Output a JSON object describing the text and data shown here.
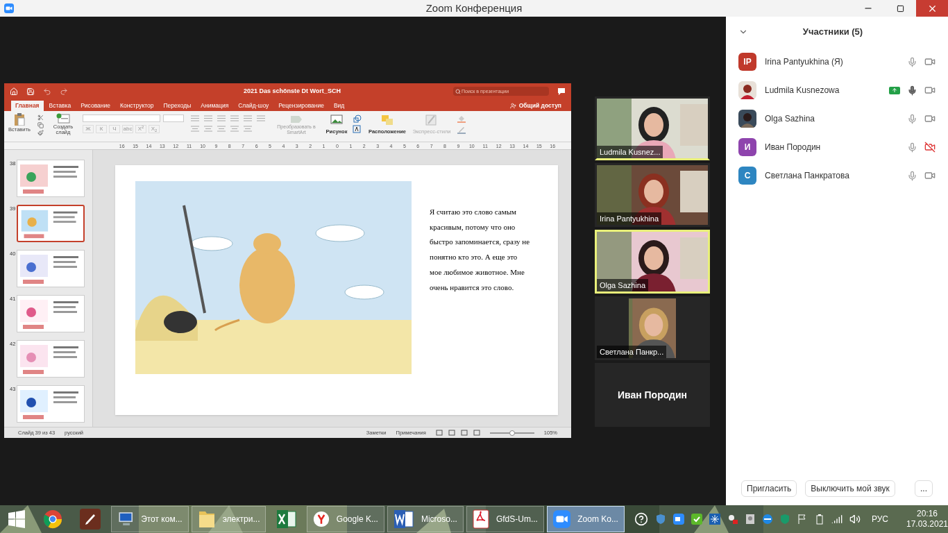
{
  "window": {
    "title": "Zoom Конференция"
  },
  "presentation": {
    "title": "2021 Das schönste Dt Wort_SCH",
    "search_placeholder": "Поиск в презентации",
    "share": "Общий доступ",
    "tabs": [
      {
        "label": "Главная",
        "selected": true
      },
      {
        "label": "Вставка",
        "selected": false
      },
      {
        "label": "Рисование",
        "selected": false
      },
      {
        "label": "Конструктор",
        "selected": false
      },
      {
        "label": "Переходы",
        "selected": false
      },
      {
        "label": "Анимация",
        "selected": false
      },
      {
        "label": "Слайд-шоу",
        "selected": false
      },
      {
        "label": "Рецензирование",
        "selected": false
      },
      {
        "label": "Вид",
        "selected": false
      }
    ],
    "ribbon": {
      "paste": "Вставить",
      "new_slide": "Создать слайд",
      "font_buttons": [
        "Ж",
        "К",
        "Ч",
        "abc",
        "X$^{2}$",
        "X$_{2}$"
      ],
      "smartart": "Преобразовать в SmartArt",
      "picture": "Рисунок",
      "arrange": "Расположение",
      "styles": "Экспресс-стили"
    },
    "ruler": [
      "16",
      "15",
      "14",
      "13",
      "12",
      "11",
      "10",
      "9",
      "8",
      "7",
      "6",
      "5",
      "4",
      "3",
      "2",
      "1",
      "0",
      "1",
      "2",
      "3",
      "4",
      "5",
      "6",
      "7",
      "8",
      "9",
      "10",
      "11",
      "12",
      "13",
      "14",
      "15",
      "16"
    ],
    "thumbnails": [
      {
        "number": "38",
        "selected": false
      },
      {
        "number": "39",
        "selected": true
      },
      {
        "number": "40",
        "selected": false
      },
      {
        "number": "41",
        "selected": false
      },
      {
        "number": "42",
        "selected": false
      },
      {
        "number": "43",
        "selected": false
      }
    ],
    "slide": {
      "text": "Я считаю это слово самым красивым, потому что оно быстро запоминается, сразу не понятно кто это. А еще это мое любимое животное. Мне очень нравится это слово."
    },
    "status": {
      "slide_info": "Слайд 39 из 43",
      "language": "русский",
      "notes": "Заметки",
      "comments": "Примечания",
      "zoom": "105%",
      "level": 0.5
    }
  },
  "videos": [
    {
      "name": "Ludmila Kusnez...",
      "kind": "video",
      "selected": false,
      "speaking": true
    },
    {
      "name": "Irina Pantyukhina",
      "kind": "video",
      "selected": false,
      "speaking": false
    },
    {
      "name": "Olga Sazhina",
      "kind": "video",
      "selected": true,
      "speaking": false
    },
    {
      "name": "Светлана Панкр...",
      "kind": "video",
      "selected": false,
      "speaking": false
    },
    {
      "name": "Иван Породин",
      "kind": "name",
      "selected": false,
      "speaking": false
    }
  ],
  "participants": {
    "title": "Участники (5)",
    "items": [
      {
        "name": "Irina Pantyukhina (Я)",
        "kind": "initials",
        "initials": "IP",
        "color": "#c0392b",
        "sharing": false,
        "mic_active": false,
        "video_off": false
      },
      {
        "name": "Ludmila Kusnezowa",
        "sharing": true,
        "mic_active": true,
        "video_off": false
      },
      {
        "name": "Olga Sazhina",
        "sharing": false,
        "mic_active": false,
        "video_off": false
      },
      {
        "name": "Иван Породин",
        "kind": "initials",
        "initials": "И",
        "color": "#8e44ad",
        "sharing": false,
        "mic_active": false,
        "video_off": true
      },
      {
        "name": "Светлана Панкратова",
        "kind": "initials",
        "initials": "С",
        "color": "#2e86c1",
        "sharing": false,
        "mic_active": false,
        "video_off": false
      }
    ],
    "buttons": [
      "Пригласить",
      "Выключить мой звук",
      "..."
    ]
  },
  "taskbar": {
    "items": [
      {
        "kind": "start"
      },
      {
        "kind": "chrome"
      },
      {
        "kind": "pen"
      },
      {
        "kind": "computer",
        "label": "Этот ком...",
        "selected": false
      },
      {
        "kind": "folder",
        "label": "электри...",
        "selected": false
      },
      {
        "kind": "excel"
      },
      {
        "kind": "yandex",
        "label": "Google K...",
        "selected": false
      },
      {
        "kind": "word",
        "label": "Microso...",
        "selected": false
      },
      {
        "kind": "pdf",
        "label": "GfdS-Um...",
        "selected": false
      },
      {
        "kind": "zoom",
        "label": "Zoom Ko...",
        "selected": true
      }
    ],
    "language": "РУС",
    "time": "20:16",
    "date": "17.03.2021"
  }
}
